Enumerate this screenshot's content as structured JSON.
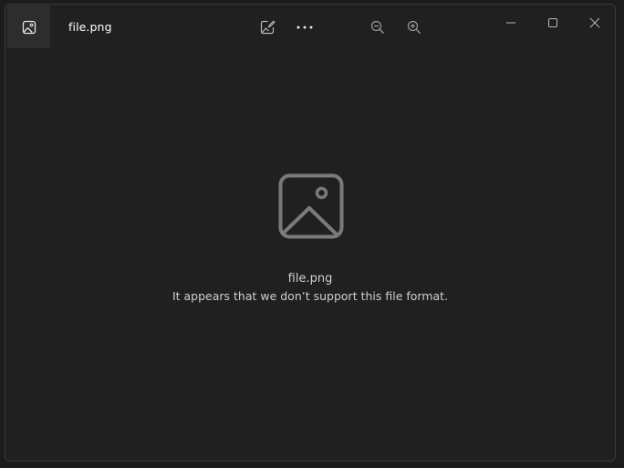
{
  "titlebar": {
    "file_name": "file.png",
    "app_icon": "image-icon",
    "edit_icon": "edit-image-icon",
    "more_icon": "more-icon",
    "zoom_out_icon": "zoom-out-icon",
    "zoom_in_icon": "zoom-in-icon",
    "minimize_icon": "minimize-icon",
    "maximize_icon": "maximize-icon",
    "close_icon": "close-icon"
  },
  "content": {
    "placeholder_icon": "image-placeholder-icon",
    "file_name": "file.png",
    "message": "It appears that we don’t support this file format."
  },
  "colors": {
    "background": "#202020",
    "tile": "#2d2d2d",
    "text": "#cfcfcf",
    "icon": "#7a7a7a"
  }
}
